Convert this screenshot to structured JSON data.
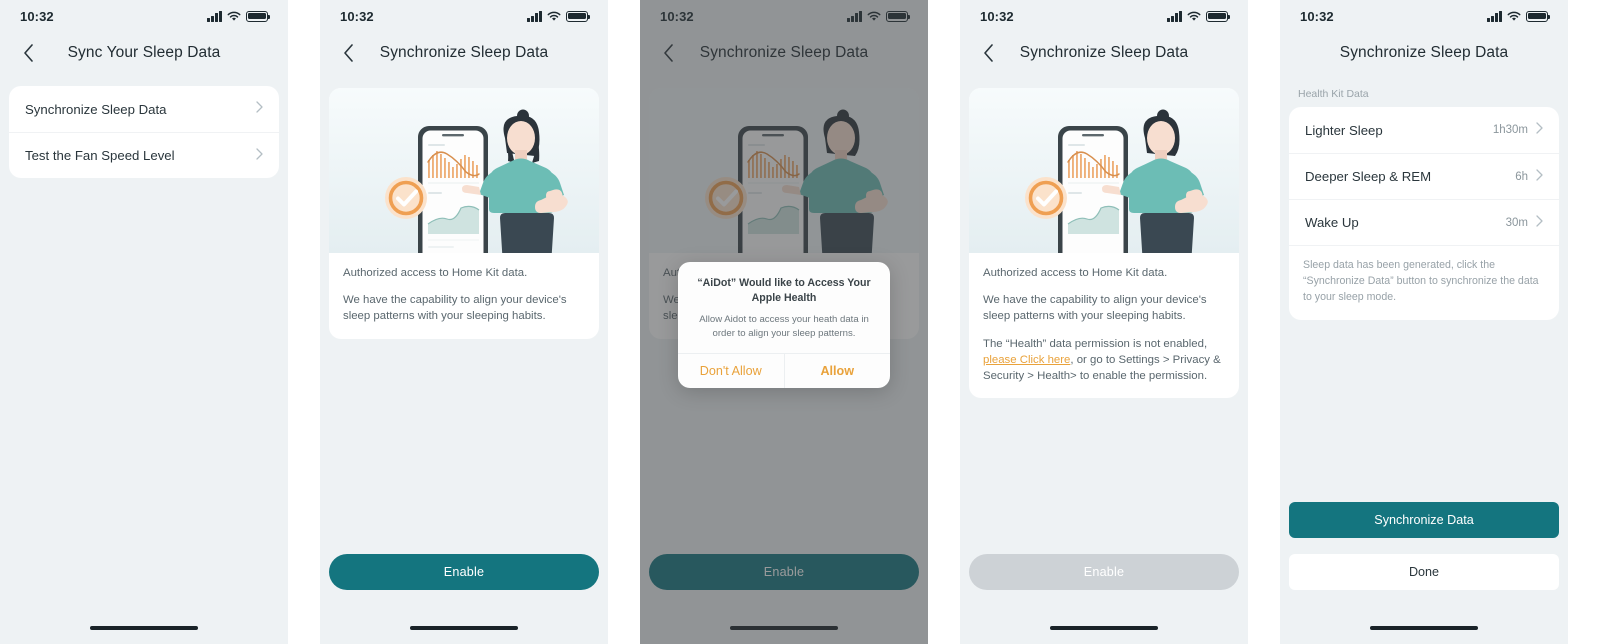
{
  "status_bar": {
    "time": "10:32",
    "signal_icon": "signal-bars-icon",
    "wifi_icon": "wifi-icon",
    "battery_icon": "battery-full-icon"
  },
  "icons": {
    "back": "chevron-left-icon",
    "disclosure": "chevron-right-icon"
  },
  "screens": [
    {
      "id": "sync-your-sleep-data",
      "title": "Sync Your Sleep Data",
      "has_back": true,
      "menu": [
        {
          "label": "Synchronize Sleep Data"
        },
        {
          "label": "Test the Fan Speed Level"
        }
      ]
    },
    {
      "id": "synchronize-sleep-data-default",
      "title": "Synchronize Sleep Data",
      "has_back": true,
      "paragraphs": [
        "Authorized access to Home Kit data.",
        "We have the capability to align your device's sleep patterns with your sleeping habits."
      ],
      "cta": {
        "label": "Enable",
        "disabled": false
      }
    },
    {
      "id": "synchronize-sleep-data-permission-dialog",
      "title": "Synchronize Sleep Data",
      "has_back": true,
      "paragraphs": [
        "Authorized access to Home Kit data.",
        "We have the capability to align your device's sleep patterns with your sleeping habits."
      ],
      "cta": {
        "label": "Enable",
        "disabled": false
      },
      "dialog": {
        "title": "“AiDot” Would like to Access Your Apple Health",
        "message": "Allow Aidot to access your heath data in order to align your sleep patterns.",
        "deny_label": "Don't Allow",
        "allow_label": "Allow"
      }
    },
    {
      "id": "synchronize-sleep-data-denied",
      "title": "Synchronize Sleep Data",
      "has_back": true,
      "paragraphs": [
        "Authorized access to Home Kit data.",
        "We have the capability to align your device's sleep patterns with your sleeping habits."
      ],
      "error": {
        "before_link": "The “Health” data permission is not enabled, ",
        "link": "please Click here",
        "after_link": ", or go to Settings > Privacy & Security > Health>  to enable the permission."
      },
      "cta": {
        "label": "Enable",
        "disabled": true
      }
    },
    {
      "id": "synchronize-sleep-data-results",
      "title": "Synchronize Sleep Data",
      "has_back": false,
      "section_label": "Health Kit Data",
      "rows": [
        {
          "label": "Lighter Sleep",
          "value": "1h30m"
        },
        {
          "label": "Deeper Sleep & REM",
          "value": "6h"
        },
        {
          "label": "Wake Up",
          "value": "30m"
        }
      ],
      "note": "Sleep data has been generated, click the “Synchronize Data” button to synchronize the data to your sleep mode.",
      "primary_cta": "Synchronize Data",
      "secondary_cta": "Done"
    }
  ],
  "colors": {
    "accent_teal": "#14757f",
    "accent_orange": "#e9a23b",
    "screen_bg": "#eef2f4",
    "card_bg": "#ffffff",
    "disabled_gray": "#cdd2d6",
    "text_primary": "#2a363c",
    "text_secondary": "#5a676e"
  }
}
